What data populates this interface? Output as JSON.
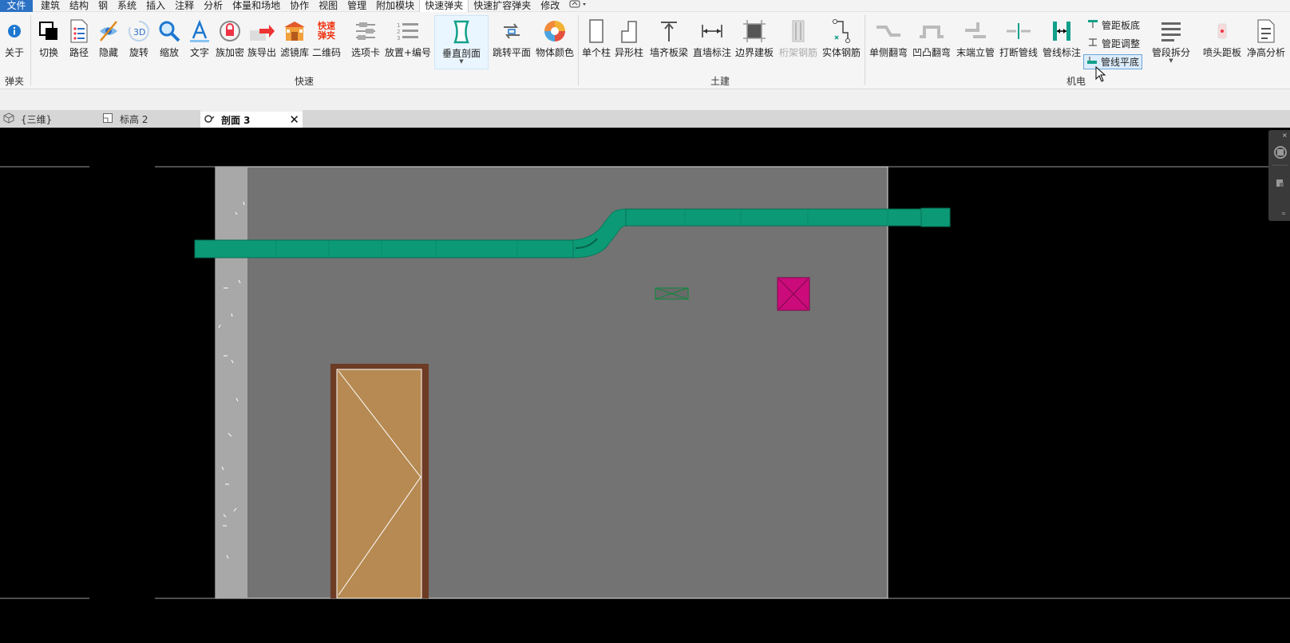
{
  "menu": {
    "items": [
      "文件",
      "建筑",
      "结构",
      "钢",
      "系统",
      "插入",
      "注释",
      "分析",
      "体量和场地",
      "协作",
      "视图",
      "管理",
      "附加模块",
      "快速弹夹",
      "快速扩容弹夹",
      "修改"
    ],
    "active_index": 13
  },
  "ribbon": {
    "about": "关于",
    "quick": {
      "switch": "切换",
      "path": "路径",
      "hide": "隐藏",
      "rotate": "旋转",
      "zoom": "缩放",
      "text": "文字",
      "family_encrypt": "族加密",
      "family_export": "族导出",
      "filter_lib": "滤镜库",
      "qrcode": "二维码",
      "option_card": "选项卡",
      "place_number": "放置+编号",
      "vertical_section": "垂直剖面",
      "jump_plane": "跳转平面",
      "object_color": "物体颜色",
      "logo_line1": "快速",
      "logo_line2": "弹夹"
    },
    "civil": {
      "single_column": "单个柱",
      "special_column": "异形柱",
      "wall_align": "墙齐板梁",
      "straight_wall_dim": "直墙标注",
      "boundary_slab": "边界建板",
      "truss_rebar": "桁架钢筋",
      "solid_rebar": "实体钢筋"
    },
    "mep": {
      "single_bend": "单侧翻弯",
      "convex_bend": "凹凸翻弯",
      "end_riser": "末端立管",
      "break_pipe": "打断管线",
      "pipe_label": "管线标注",
      "pipe_slab_bottom": "管距板底",
      "pipe_spacing_adjust": "管距调整",
      "pipe_flat_bottom": "管线平底",
      "segment_split": "管段拆分",
      "sprinkler_slab": "喷头距板",
      "clear_height": "净高分析"
    },
    "groups": {
      "clip": "弹夹",
      "quick": "快速",
      "civil": "土建",
      "mep": "机电"
    }
  },
  "tabs": [
    {
      "label": "{三维}"
    },
    {
      "label": "标高 2"
    },
    {
      "label": "剖面 3",
      "active": true
    }
  ],
  "colors": {
    "accent": "#2b71c4",
    "duct": "#0b9a75",
    "wall": "#737373",
    "door": "#b68a52",
    "door_frame": "#6e3b24",
    "equipment": "#cc0b7b"
  }
}
